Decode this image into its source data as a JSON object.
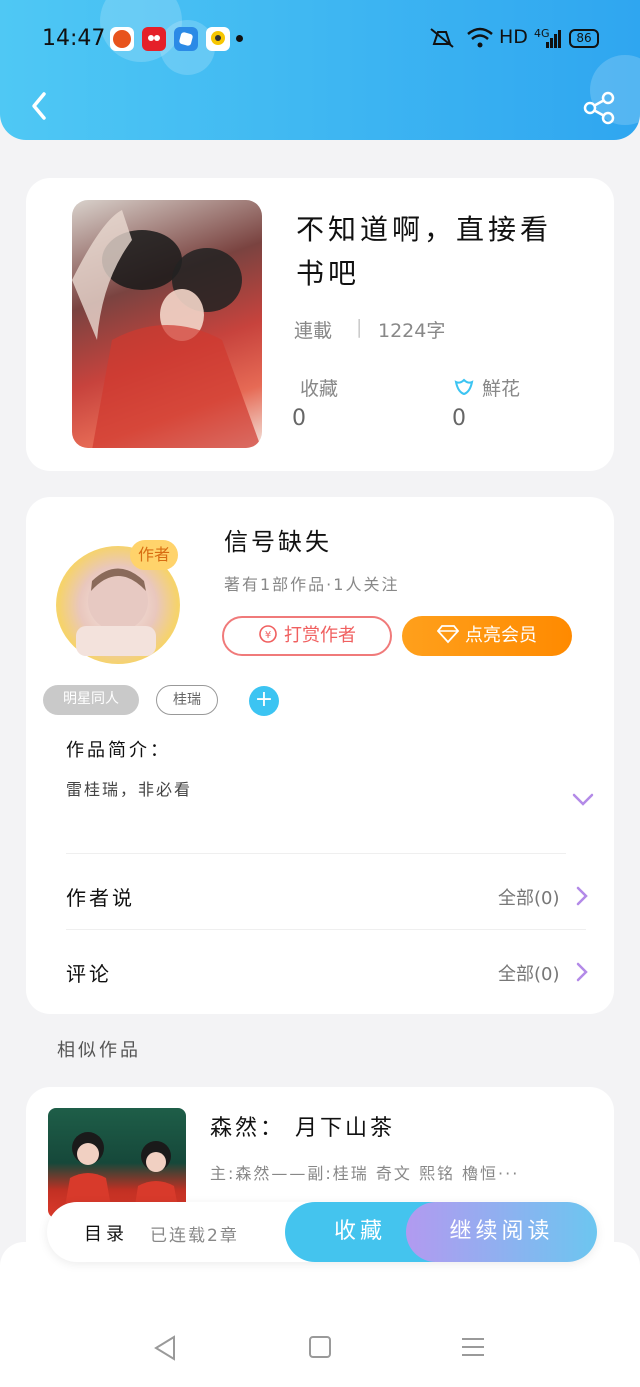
{
  "status_bar": {
    "time": "14:47",
    "network": "HD",
    "cellular": "4G",
    "battery": "86"
  },
  "header": {
    "back_icon": "chevron-left-icon",
    "share_icon": "share-icon"
  },
  "book": {
    "title": "不知道啊，直接看书吧",
    "status": "連載",
    "word_count": "1224字",
    "favorites_label": "收藏",
    "favorites_count": "0",
    "flowers_label": "鮮花",
    "flowers_count": "0"
  },
  "author": {
    "badge": "作者",
    "name": "信号缺失",
    "meta": "著有1部作品·1人关注",
    "tip_button": "打赏作者",
    "vip_button": "点亮会员",
    "tags": [
      "明星同人",
      "桂瑞"
    ],
    "intro_label": "作品简介：",
    "intro_text": "雷桂瑞，非必看",
    "author_says_label": "作者说",
    "author_says_count": "全部(0)",
    "comments_label": "评论",
    "comments_count": "全部(0)"
  },
  "similar": {
    "section_title": "相似作品",
    "items": [
      {
        "title": "森然： 月下山茶",
        "desc": "主:森然——副:桂瑞 奇文 熙铭 櫓恒···"
      }
    ]
  },
  "action_bar": {
    "toc_label": "目录",
    "progress": "已连载2章",
    "favorite_button": "收藏",
    "continue_button": "继续阅读"
  },
  "colors": {
    "header_start": "#4fc8f4",
    "header_end": "#2fa6f0",
    "vip_orange": "#ff8a00",
    "tip_red": "#f06060",
    "accent_blue": "#44c4ee",
    "accent_purple": "#b29af0"
  }
}
